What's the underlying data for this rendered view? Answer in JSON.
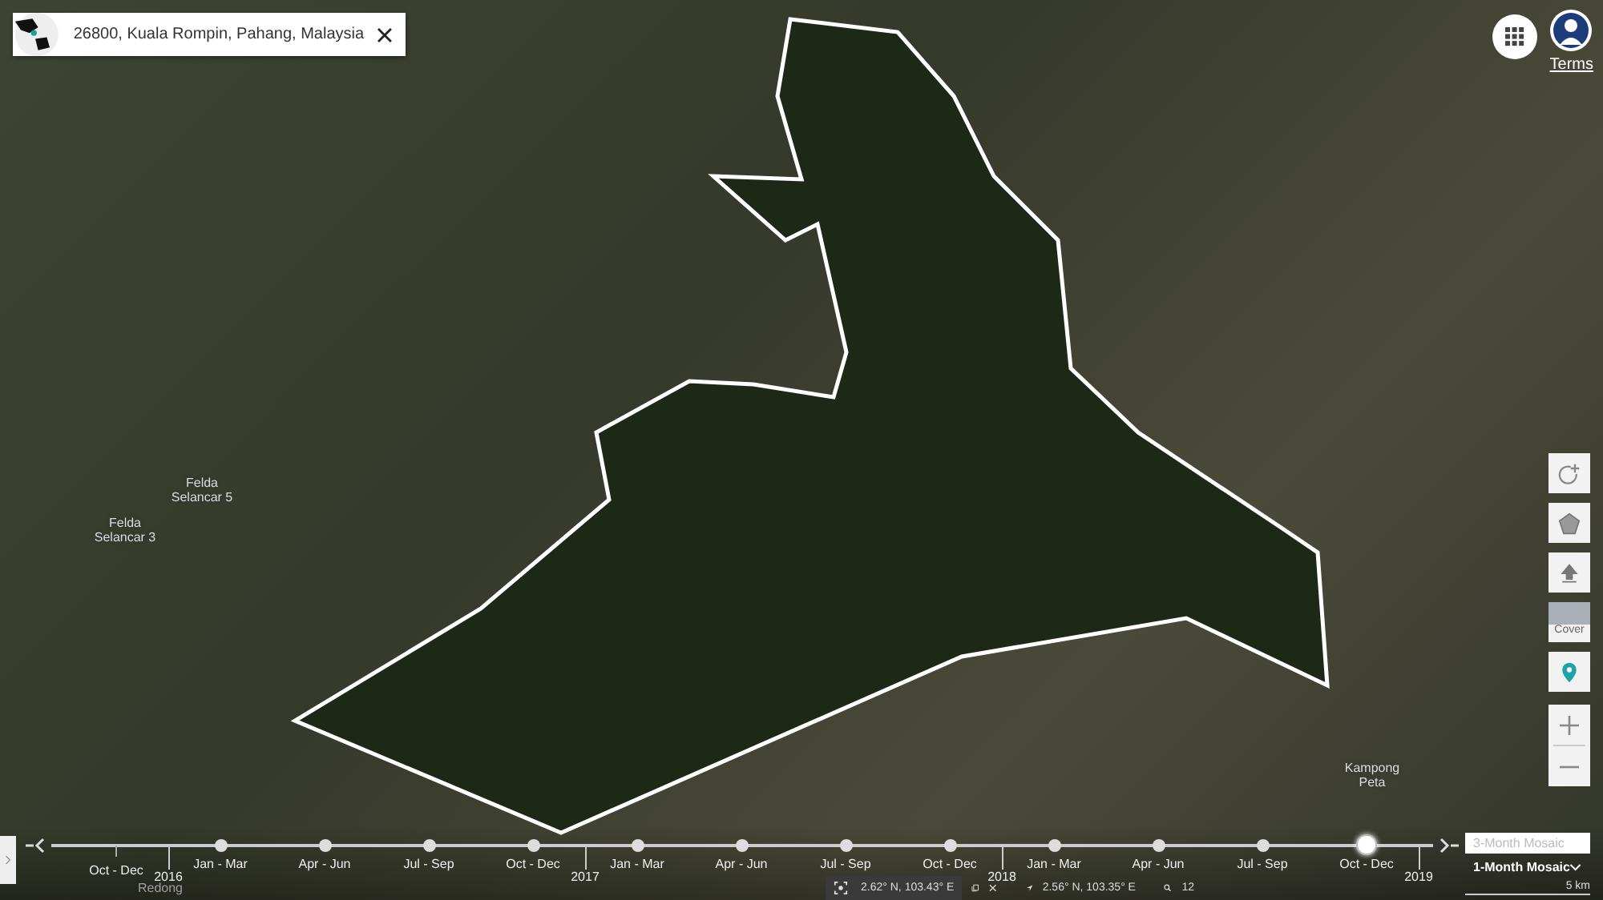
{
  "search": {
    "value": "26800, Kuala Rompin, Pahang, Malaysia"
  },
  "header": {
    "terms_link": "Terms"
  },
  "map_labels": [
    {
      "text": "Felda Selancar 5"
    },
    {
      "text": "Felda Selancar 3"
    },
    {
      "text": "Kampong Peta"
    },
    {
      "text": "Redong"
    }
  ],
  "tools": [
    {
      "kind": "draw"
    },
    {
      "kind": "polygon"
    },
    {
      "kind": "upload"
    },
    {
      "kind": "cover",
      "label": "Cover"
    },
    {
      "kind": "pin"
    }
  ],
  "timeline": {
    "periods": [
      {
        "label": "Oct - Dec",
        "kind": "tick",
        "selected": false,
        "year_after": "2016"
      },
      {
        "label": "Jan - Mar",
        "kind": "dot",
        "selected": false
      },
      {
        "label": "Apr - Jun",
        "kind": "dot",
        "selected": false
      },
      {
        "label": "Jul - Sep",
        "kind": "dot",
        "selected": false
      },
      {
        "label": "Oct - Dec",
        "kind": "dot",
        "selected": false,
        "year_after": "2017"
      },
      {
        "label": "Jan - Mar",
        "kind": "dot",
        "selected": false
      },
      {
        "label": "Apr - Jun",
        "kind": "dot",
        "selected": false
      },
      {
        "label": "Jul - Sep",
        "kind": "dot",
        "selected": false
      },
      {
        "label": "Oct - Dec",
        "kind": "dot",
        "selected": false,
        "year_after": "2018"
      },
      {
        "label": "Jan - Mar",
        "kind": "dot",
        "selected": false
      },
      {
        "label": "Apr - Jun",
        "kind": "dot",
        "selected": false
      },
      {
        "label": "Jul - Sep",
        "kind": "dot",
        "selected": false
      },
      {
        "label": "Oct - Dec",
        "kind": "dot",
        "selected": true,
        "year_after": "2019"
      }
    ],
    "mosaics": [
      {
        "label": "3-Month Mosaic",
        "selected": false
      },
      {
        "label": "1-Month Mosaic",
        "selected": true
      }
    ]
  },
  "status_bar": {
    "cursor_coords": "2.62° N, 103.43° E",
    "location_coords": "2.56° N, 103.35° E",
    "zoom": "12",
    "scale": "5 km"
  }
}
